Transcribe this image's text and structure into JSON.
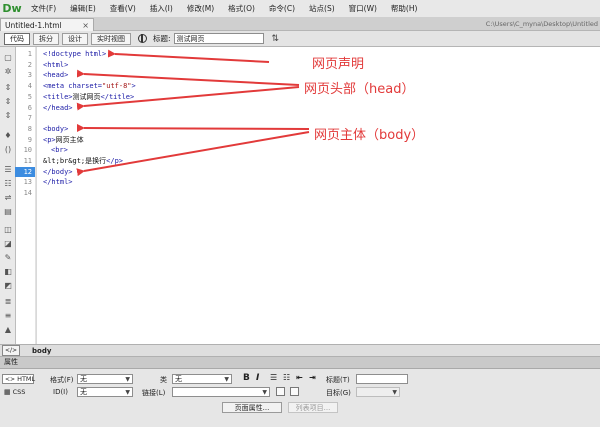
{
  "app": {
    "logo": "Dw"
  },
  "menu": [
    "文件(F)",
    "编辑(E)",
    "查看(V)",
    "插入(I)",
    "修改(M)",
    "格式(O)",
    "命令(C)",
    "站点(S)",
    "窗口(W)",
    "帮助(H)"
  ],
  "tab": {
    "name": "Untitled-1.html",
    "close": "×",
    "path": "C:\\Users\\C_myna\\Desktop\\Untitled"
  },
  "toolbar": {
    "views": [
      "代码",
      "拆分",
      "设计",
      "实时视图"
    ],
    "title_label": "标题:",
    "title_value": "测试网页"
  },
  "editor": {
    "line_numbers": [
      "1",
      "2",
      "3",
      "4",
      "5",
      "6",
      "7",
      "8",
      "9",
      "10",
      "11",
      "12",
      "13",
      "14"
    ],
    "current_line": "12",
    "code": {
      "l1": "<!doctype html>",
      "l2": "<html>",
      "l3": "<head>",
      "l4a": "<meta ",
      "l4b": "charset=",
      "l4c": "\"utf-8\"",
      "l4d": ">",
      "l5a": "<title>",
      "l5b": "测试网页",
      "l5c": "</title>",
      "l6": "</head>",
      "l8": "<body>",
      "l9a": "<p>",
      "l9b": "网页主体",
      "l10": "<br>",
      "l11a": "&lt;br&gt;",
      "l11b": "是换行",
      "l11c": "</p>",
      "l12": "</body>",
      "l13": "</html>"
    }
  },
  "annotations": {
    "declaration": "网页声明",
    "head": "网页头部（head）",
    "body": "网页主体（body）"
  },
  "tagbar": {
    "icon": "</>",
    "tag": "body"
  },
  "properties": {
    "header": "属性",
    "html_btn": "HTML",
    "css_btn": "CSS",
    "format_label": "格式(F)",
    "format_value": "无",
    "class_label": "类",
    "class_value": "无",
    "bold": "B",
    "italic": "I",
    "title_label": "标题(T)",
    "id_label": "ID(I)",
    "id_value": "无",
    "link_label": "链接(L)",
    "target_label": "目标(G)",
    "page_props_btn": "页面属性...",
    "list_item_btn": "列表项目..."
  },
  "colors": {
    "arrow": "#e23a3a",
    "accent": "#3c8ce0"
  }
}
